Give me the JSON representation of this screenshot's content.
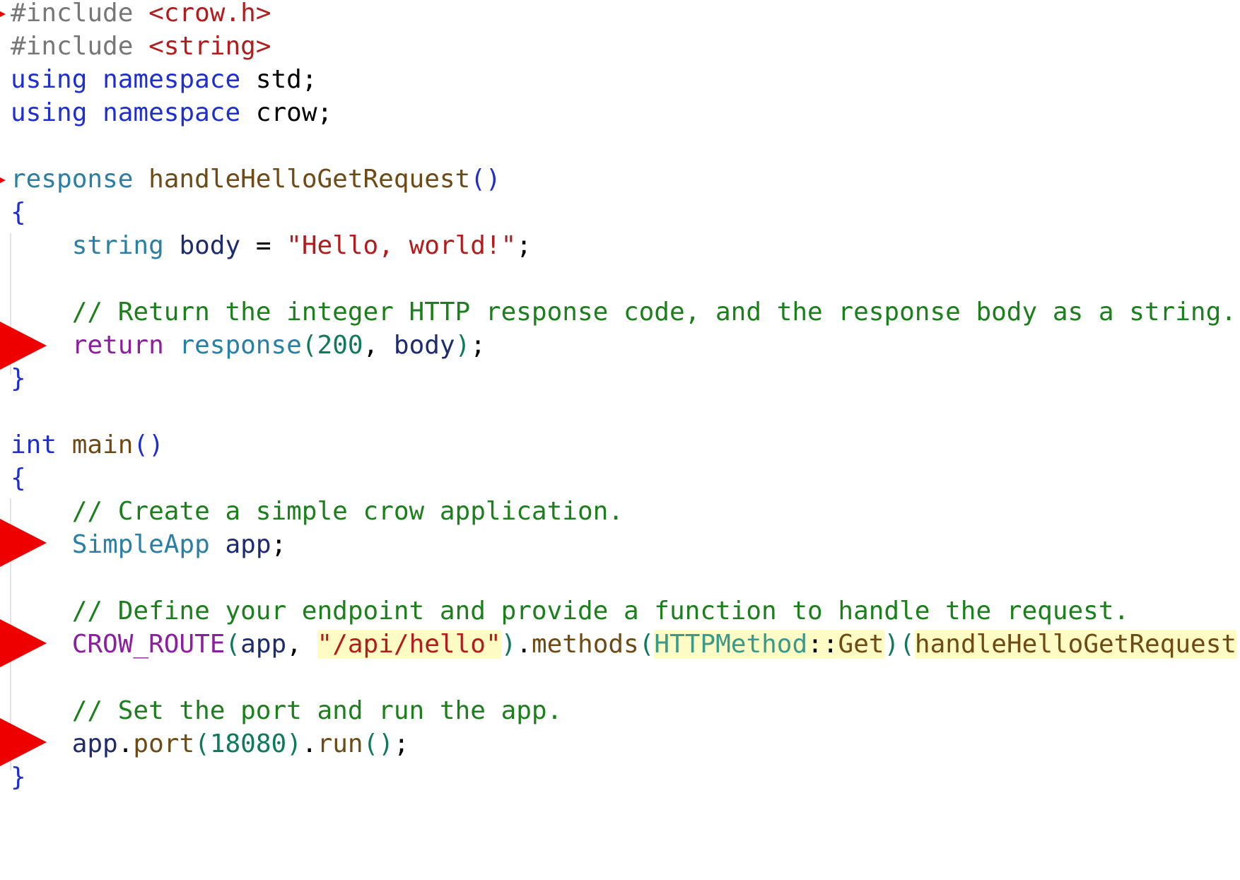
{
  "editor": {
    "colors": {
      "text": "#000000",
      "preprocessor": "#777777",
      "include_path": "#b31c1c",
      "keyword": "#1f2fcf",
      "type": "#2a7fa6",
      "function": "#6e4a14",
      "string": "#b31c1c",
      "comment": "#1b7f1b",
      "number": "#0e7a5a",
      "control": "#8b1f9f",
      "variable": "#1f2b6f",
      "macro": "#8b1f9f",
      "enum_type": "#3a9a8a",
      "highlight": "#fffbc4",
      "arrow": "#ee0000"
    },
    "lines": [
      [
        {
          "t": "#include ",
          "c": "preprocessor"
        },
        {
          "t": "<crow.h>",
          "c": "include_path"
        }
      ],
      [
        {
          "t": "#include ",
          "c": "preprocessor"
        },
        {
          "t": "<string>",
          "c": "include_path"
        }
      ],
      [
        {
          "t": "using",
          "c": "keyword"
        },
        {
          "t": " ",
          "c": "text"
        },
        {
          "t": "namespace",
          "c": "keyword"
        },
        {
          "t": " std;",
          "c": "text"
        }
      ],
      [
        {
          "t": "using",
          "c": "keyword"
        },
        {
          "t": " ",
          "c": "text"
        },
        {
          "t": "namespace",
          "c": "keyword"
        },
        {
          "t": " crow;",
          "c": "text"
        }
      ],
      [],
      [
        {
          "t": "response",
          "c": "type"
        },
        {
          "t": " ",
          "c": "text"
        },
        {
          "t": "handleHelloGetRequest",
          "c": "function"
        },
        {
          "t": "()",
          "c": "keyword"
        }
      ],
      [
        {
          "t": "{",
          "c": "keyword"
        }
      ],
      [
        {
          "t": "    ",
          "c": "text"
        },
        {
          "t": "string",
          "c": "type"
        },
        {
          "t": " ",
          "c": "text"
        },
        {
          "t": "body",
          "c": "variable"
        },
        {
          "t": " = ",
          "c": "text"
        },
        {
          "t": "\"Hello, world!\"",
          "c": "string"
        },
        {
          "t": ";",
          "c": "text"
        }
      ],
      [],
      [
        {
          "t": "    ",
          "c": "text"
        },
        {
          "t": "// Return the integer HTTP response code, and the response body as a string.",
          "c": "comment"
        }
      ],
      [
        {
          "t": "    ",
          "c": "text"
        },
        {
          "t": "return",
          "c": "control"
        },
        {
          "t": " ",
          "c": "text"
        },
        {
          "t": "response",
          "c": "type"
        },
        {
          "t": "(",
          "c": "number"
        },
        {
          "t": "200",
          "c": "number"
        },
        {
          "t": ", ",
          "c": "text"
        },
        {
          "t": "body",
          "c": "variable"
        },
        {
          "t": ")",
          "c": "number"
        },
        {
          "t": ";",
          "c": "text"
        }
      ],
      [
        {
          "t": "}",
          "c": "keyword"
        }
      ],
      [],
      [
        {
          "t": "int",
          "c": "keyword"
        },
        {
          "t": " ",
          "c": "text"
        },
        {
          "t": "main",
          "c": "function"
        },
        {
          "t": "()",
          "c": "keyword"
        }
      ],
      [
        {
          "t": "{",
          "c": "keyword"
        }
      ],
      [
        {
          "t": "    ",
          "c": "text"
        },
        {
          "t": "// Create a simple crow application.",
          "c": "comment"
        }
      ],
      [
        {
          "t": "    ",
          "c": "text"
        },
        {
          "t": "SimpleApp",
          "c": "type"
        },
        {
          "t": " ",
          "c": "text"
        },
        {
          "t": "app",
          "c": "variable"
        },
        {
          "t": ";",
          "c": "text"
        }
      ],
      [],
      [
        {
          "t": "    ",
          "c": "text"
        },
        {
          "t": "// Define your endpoint and provide a function to handle the request.",
          "c": "comment"
        }
      ],
      [
        {
          "t": "    ",
          "c": "text"
        },
        {
          "t": "CROW_ROUTE",
          "c": "macro"
        },
        {
          "t": "(",
          "c": "number"
        },
        {
          "t": "app",
          "c": "variable"
        },
        {
          "t": ", ",
          "c": "text"
        },
        {
          "t": "\"/api/hello\"",
          "c": "string",
          "hl": true
        },
        {
          "t": ")",
          "c": "number"
        },
        {
          "t": ".",
          "c": "text"
        },
        {
          "t": "methods",
          "c": "function"
        },
        {
          "t": "(",
          "c": "number"
        },
        {
          "t": "HTTPMethod",
          "c": "enum_type",
          "hl": true
        },
        {
          "t": "::",
          "c": "text",
          "hl": true
        },
        {
          "t": "Get",
          "c": "function",
          "hl": true
        },
        {
          "t": ")",
          "c": "number"
        },
        {
          "t": "(",
          "c": "number"
        },
        {
          "t": "handleHelloGetRequest",
          "c": "function",
          "hl": true
        },
        {
          "t": ")",
          "c": "number"
        },
        {
          "t": ";",
          "c": "text"
        }
      ],
      [],
      [
        {
          "t": "    ",
          "c": "text"
        },
        {
          "t": "// Set the port and run the app.",
          "c": "comment"
        }
      ],
      [
        {
          "t": "    ",
          "c": "text"
        },
        {
          "t": "app",
          "c": "variable"
        },
        {
          "t": ".",
          "c": "text"
        },
        {
          "t": "port",
          "c": "function"
        },
        {
          "t": "(",
          "c": "number"
        },
        {
          "t": "18080",
          "c": "number"
        },
        {
          "t": ")",
          "c": "number"
        },
        {
          "t": ".",
          "c": "text"
        },
        {
          "t": "run",
          "c": "function"
        },
        {
          "t": "()",
          "c": "number"
        },
        {
          "t": ";",
          "c": "text"
        }
      ],
      [
        {
          "t": "}",
          "c": "keyword"
        }
      ]
    ]
  }
}
